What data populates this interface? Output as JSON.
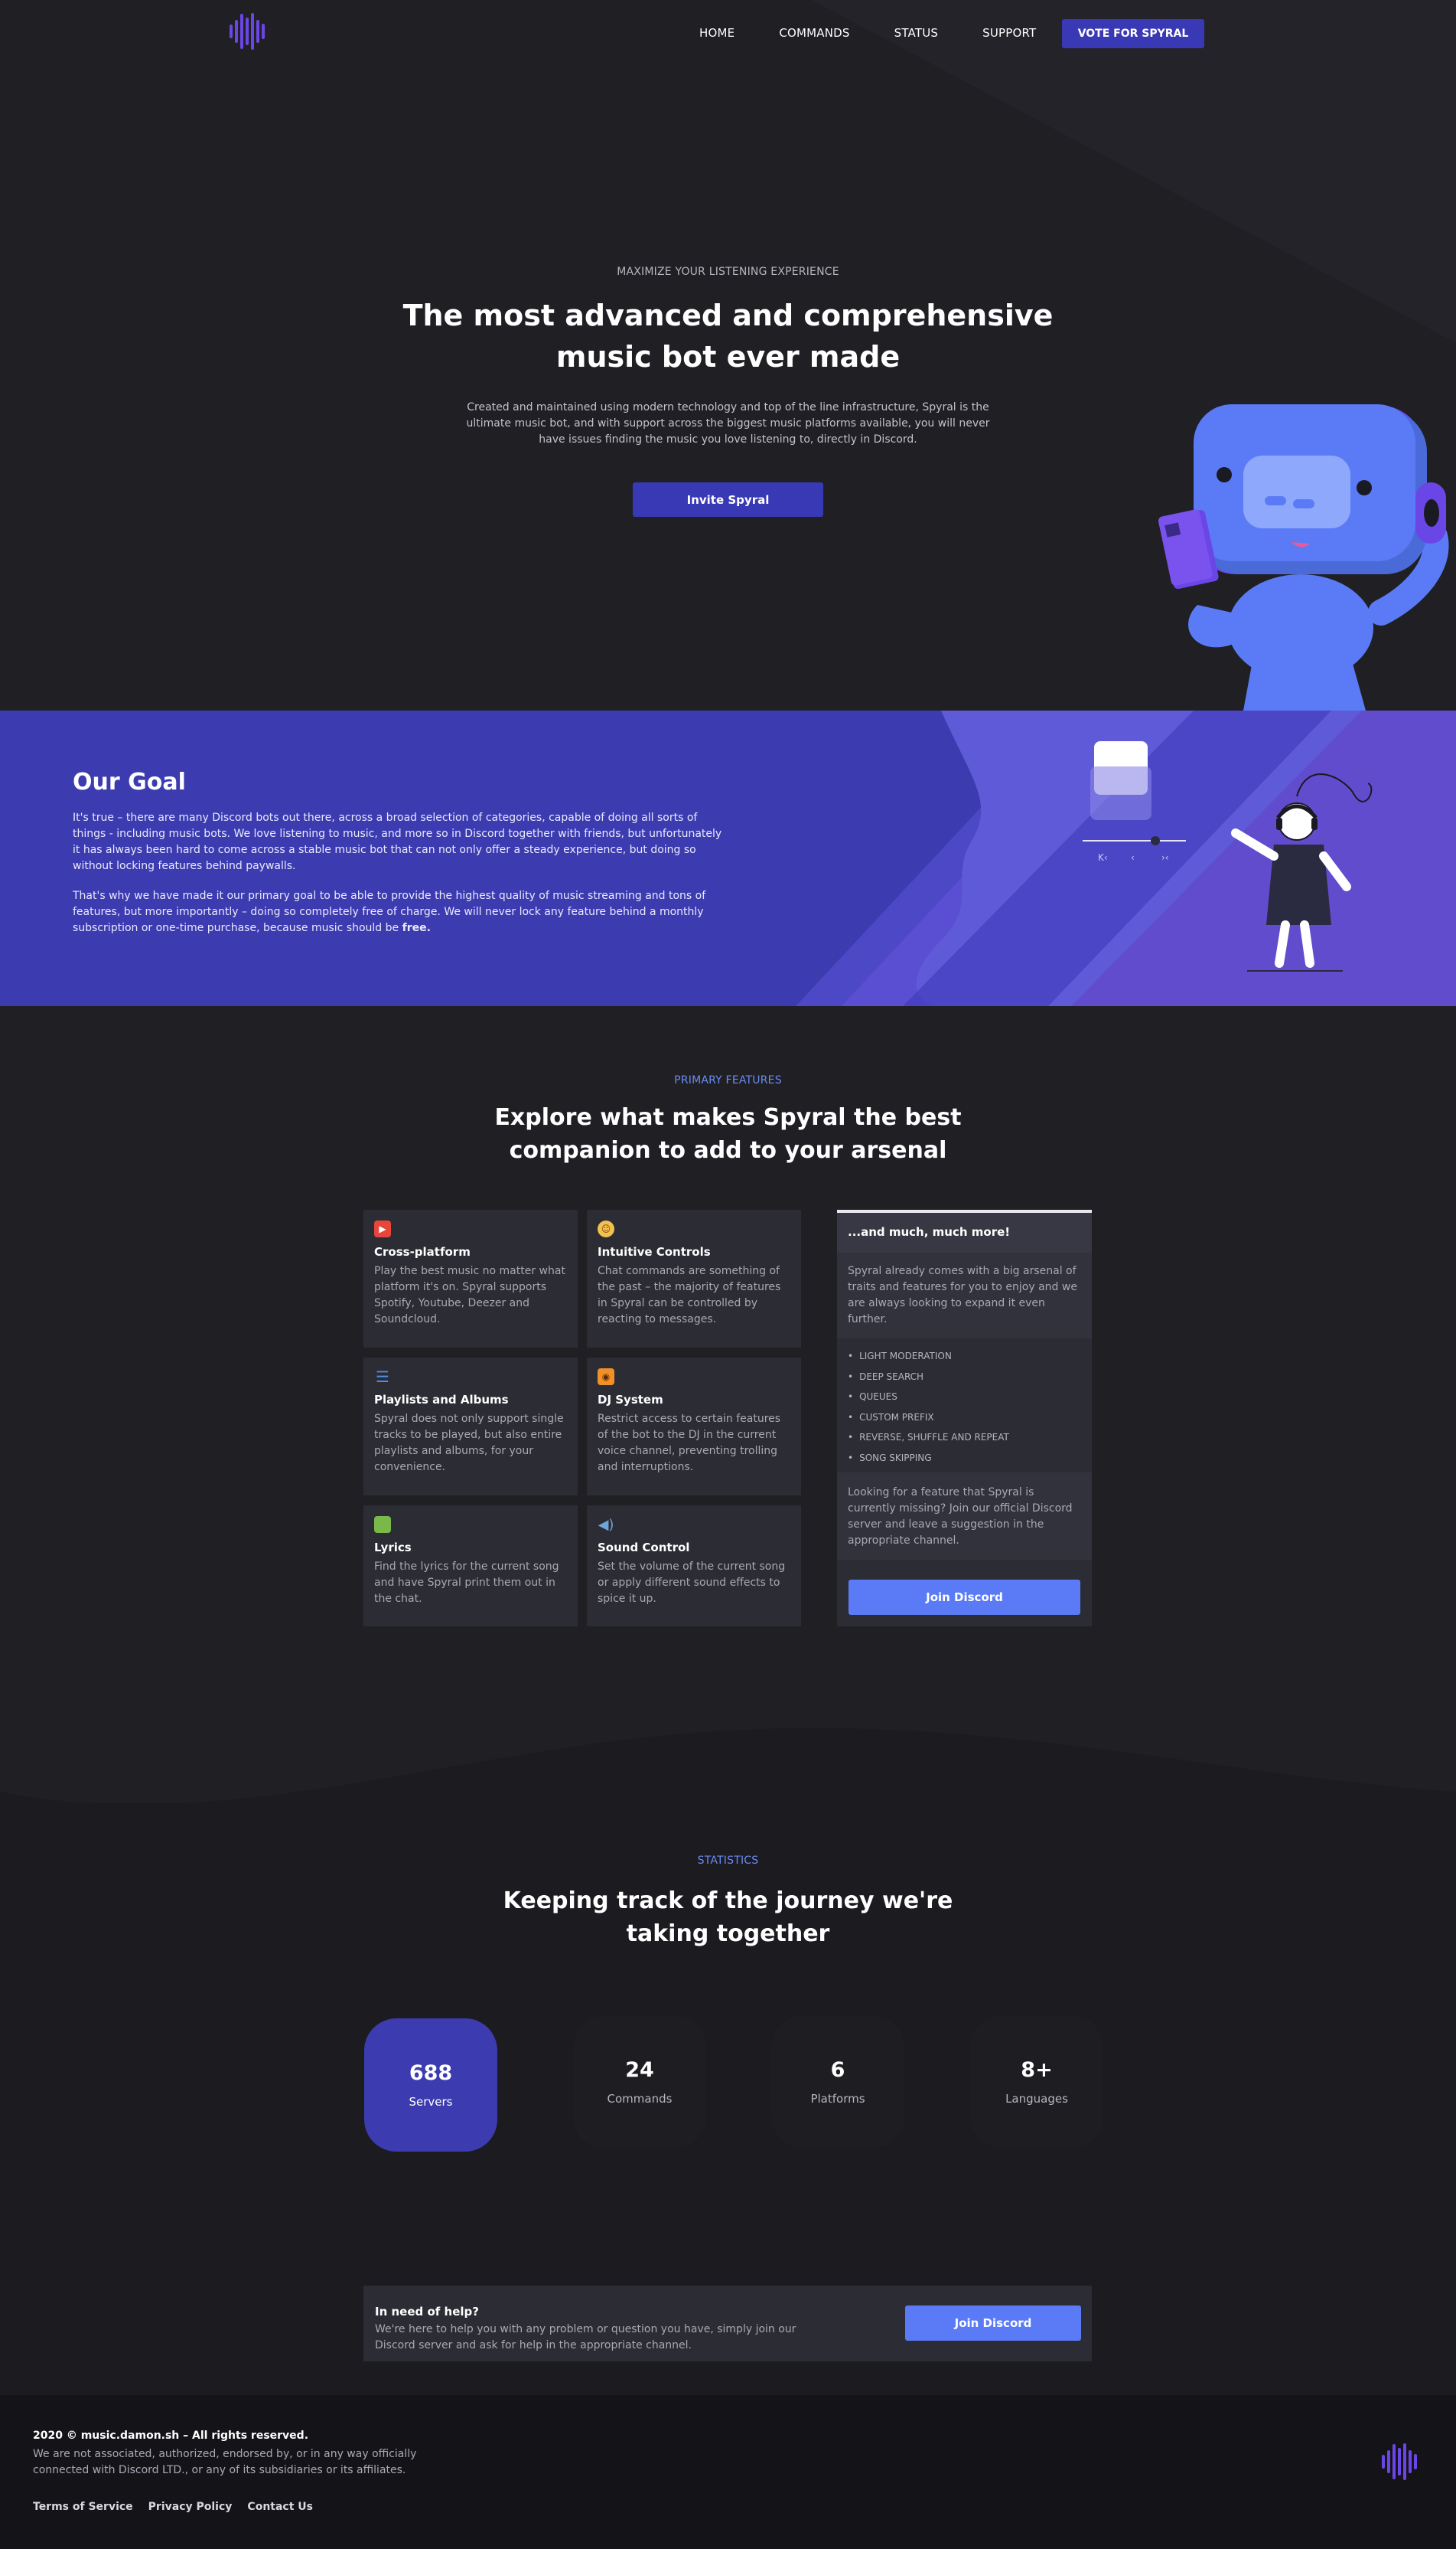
{
  "nav": {
    "links": [
      "HOME",
      "COMMANDS",
      "STATUS",
      "SUPPORT"
    ],
    "vote_label": "VOTE FOR SPYRAL"
  },
  "hero": {
    "eyebrow": "MAXIMIZE YOUR LISTENING EXPERIENCE",
    "title_line1": "The most advanced and comprehensive",
    "title_line2": "music bot ever made",
    "description": "Created and maintained using modern technology and top of the line infrastructure, Spyral is the ultimate music bot, and with support across the biggest music platforms available, you will never have issues finding the music you love listening to, directly in Discord.",
    "invite_label": "Invite Spyral"
  },
  "goal": {
    "title": "Our Goal",
    "p1": "It's true – there are many Discord bots out there, across a broad selection of categories, capable of doing all sorts of things - including music bots. We love listening to music, and more so in Discord together with friends, but unfortunately it has always been hard to come across a stable music bot that can not only offer a steady experience, but doing so without locking features behind paywalls.",
    "p2_main": "That's why we have made it our primary goal to be able to provide the highest quality of music streaming and tons of features, but more importantly – doing so completely free of charge. We will never lock any feature behind a monthly subscription or one-time purchase, because music should be ",
    "p2_bold": "free."
  },
  "features": {
    "eyebrow": "PRIMARY FEATURES",
    "title_line1": "Explore what makes Spyral the best",
    "title_line2": "companion to add to your arsenal",
    "cards": [
      {
        "title": "Cross-platform",
        "text": "Play the best music no matter what platform it's on. Spyral supports Spotify, Youtube, Deezer and Soundcloud.",
        "icon": "play-icon",
        "color": "#e8453c"
      },
      {
        "title": "Intuitive Controls",
        "text": "Chat commands are something of the past – the majority of features in Spyral can be controlled by reacting to messages.",
        "icon": "emoji-icon",
        "color": "#f4c04e"
      },
      {
        "title": "Playlists and Albums",
        "text": "Spyral does not only support single tracks to be played, but also entire playlists and albums, for your convenience.",
        "icon": "list-icon",
        "color": "#4a90e2"
      },
      {
        "title": "DJ System",
        "text": "Restrict access to certain features of the bot to the DJ in the current voice channel, preventing trolling and interruptions.",
        "icon": "radio-icon",
        "color": "#f0902a"
      },
      {
        "title": "Lyrics",
        "text": "Find the lyrics for the current song and have Spyral print them out in the chat.",
        "icon": "speech-icon",
        "color": "#7bb84a"
      },
      {
        "title": "Sound Control",
        "text": "Set the volume of the current song or apply different sound effects to spice it up.",
        "icon": "speaker-icon",
        "color": "#6fa6d8"
      }
    ],
    "more": {
      "title": "...and much, much more!",
      "intro": "Spyral already comes with a big arsenal of traits and features for you to enjoy and we are always looking to expand it even further.",
      "items": [
        "LIGHT MODERATION",
        "DEEP SEARCH",
        "QUEUES",
        "CUSTOM PREFIX",
        "REVERSE, SHUFFLE AND REPEAT",
        "SONG SKIPPING"
      ],
      "outro": "Looking for a feature that Spyral is currently missing? Join our official Discord server and leave a suggestion in the appropriate channel.",
      "button": "Join Discord"
    }
  },
  "stats": {
    "eyebrow": "STATISTICS",
    "title_line1": "Keeping track of the journey we're",
    "title_line2": "taking together",
    "items": [
      {
        "value": "688",
        "label": "Servers"
      },
      {
        "value": "24",
        "label": "Commands"
      },
      {
        "value": "6",
        "label": "Platforms"
      },
      {
        "value": "8+",
        "label": "Languages"
      }
    ]
  },
  "help": {
    "title": "In need of help?",
    "text": "We're here to help you with any problem or question you have, simply join our Discord server and ask for help in the appropriate channel.",
    "button": "Join Discord"
  },
  "footer": {
    "copyright": "2020 © music.damon.sh – All rights reserved.",
    "disclaimer": "We are not associated, authorized, endorsed by, or in any way officially connected with Discord LTD., or any of its subsidiaries or its affiliates.",
    "links": [
      "Terms of Service",
      "Privacy Policy",
      "Contact Us"
    ]
  },
  "colors": {
    "accent": "#3a39b5",
    "blurple": "#5b7bf6",
    "background": "#1f1f24"
  }
}
